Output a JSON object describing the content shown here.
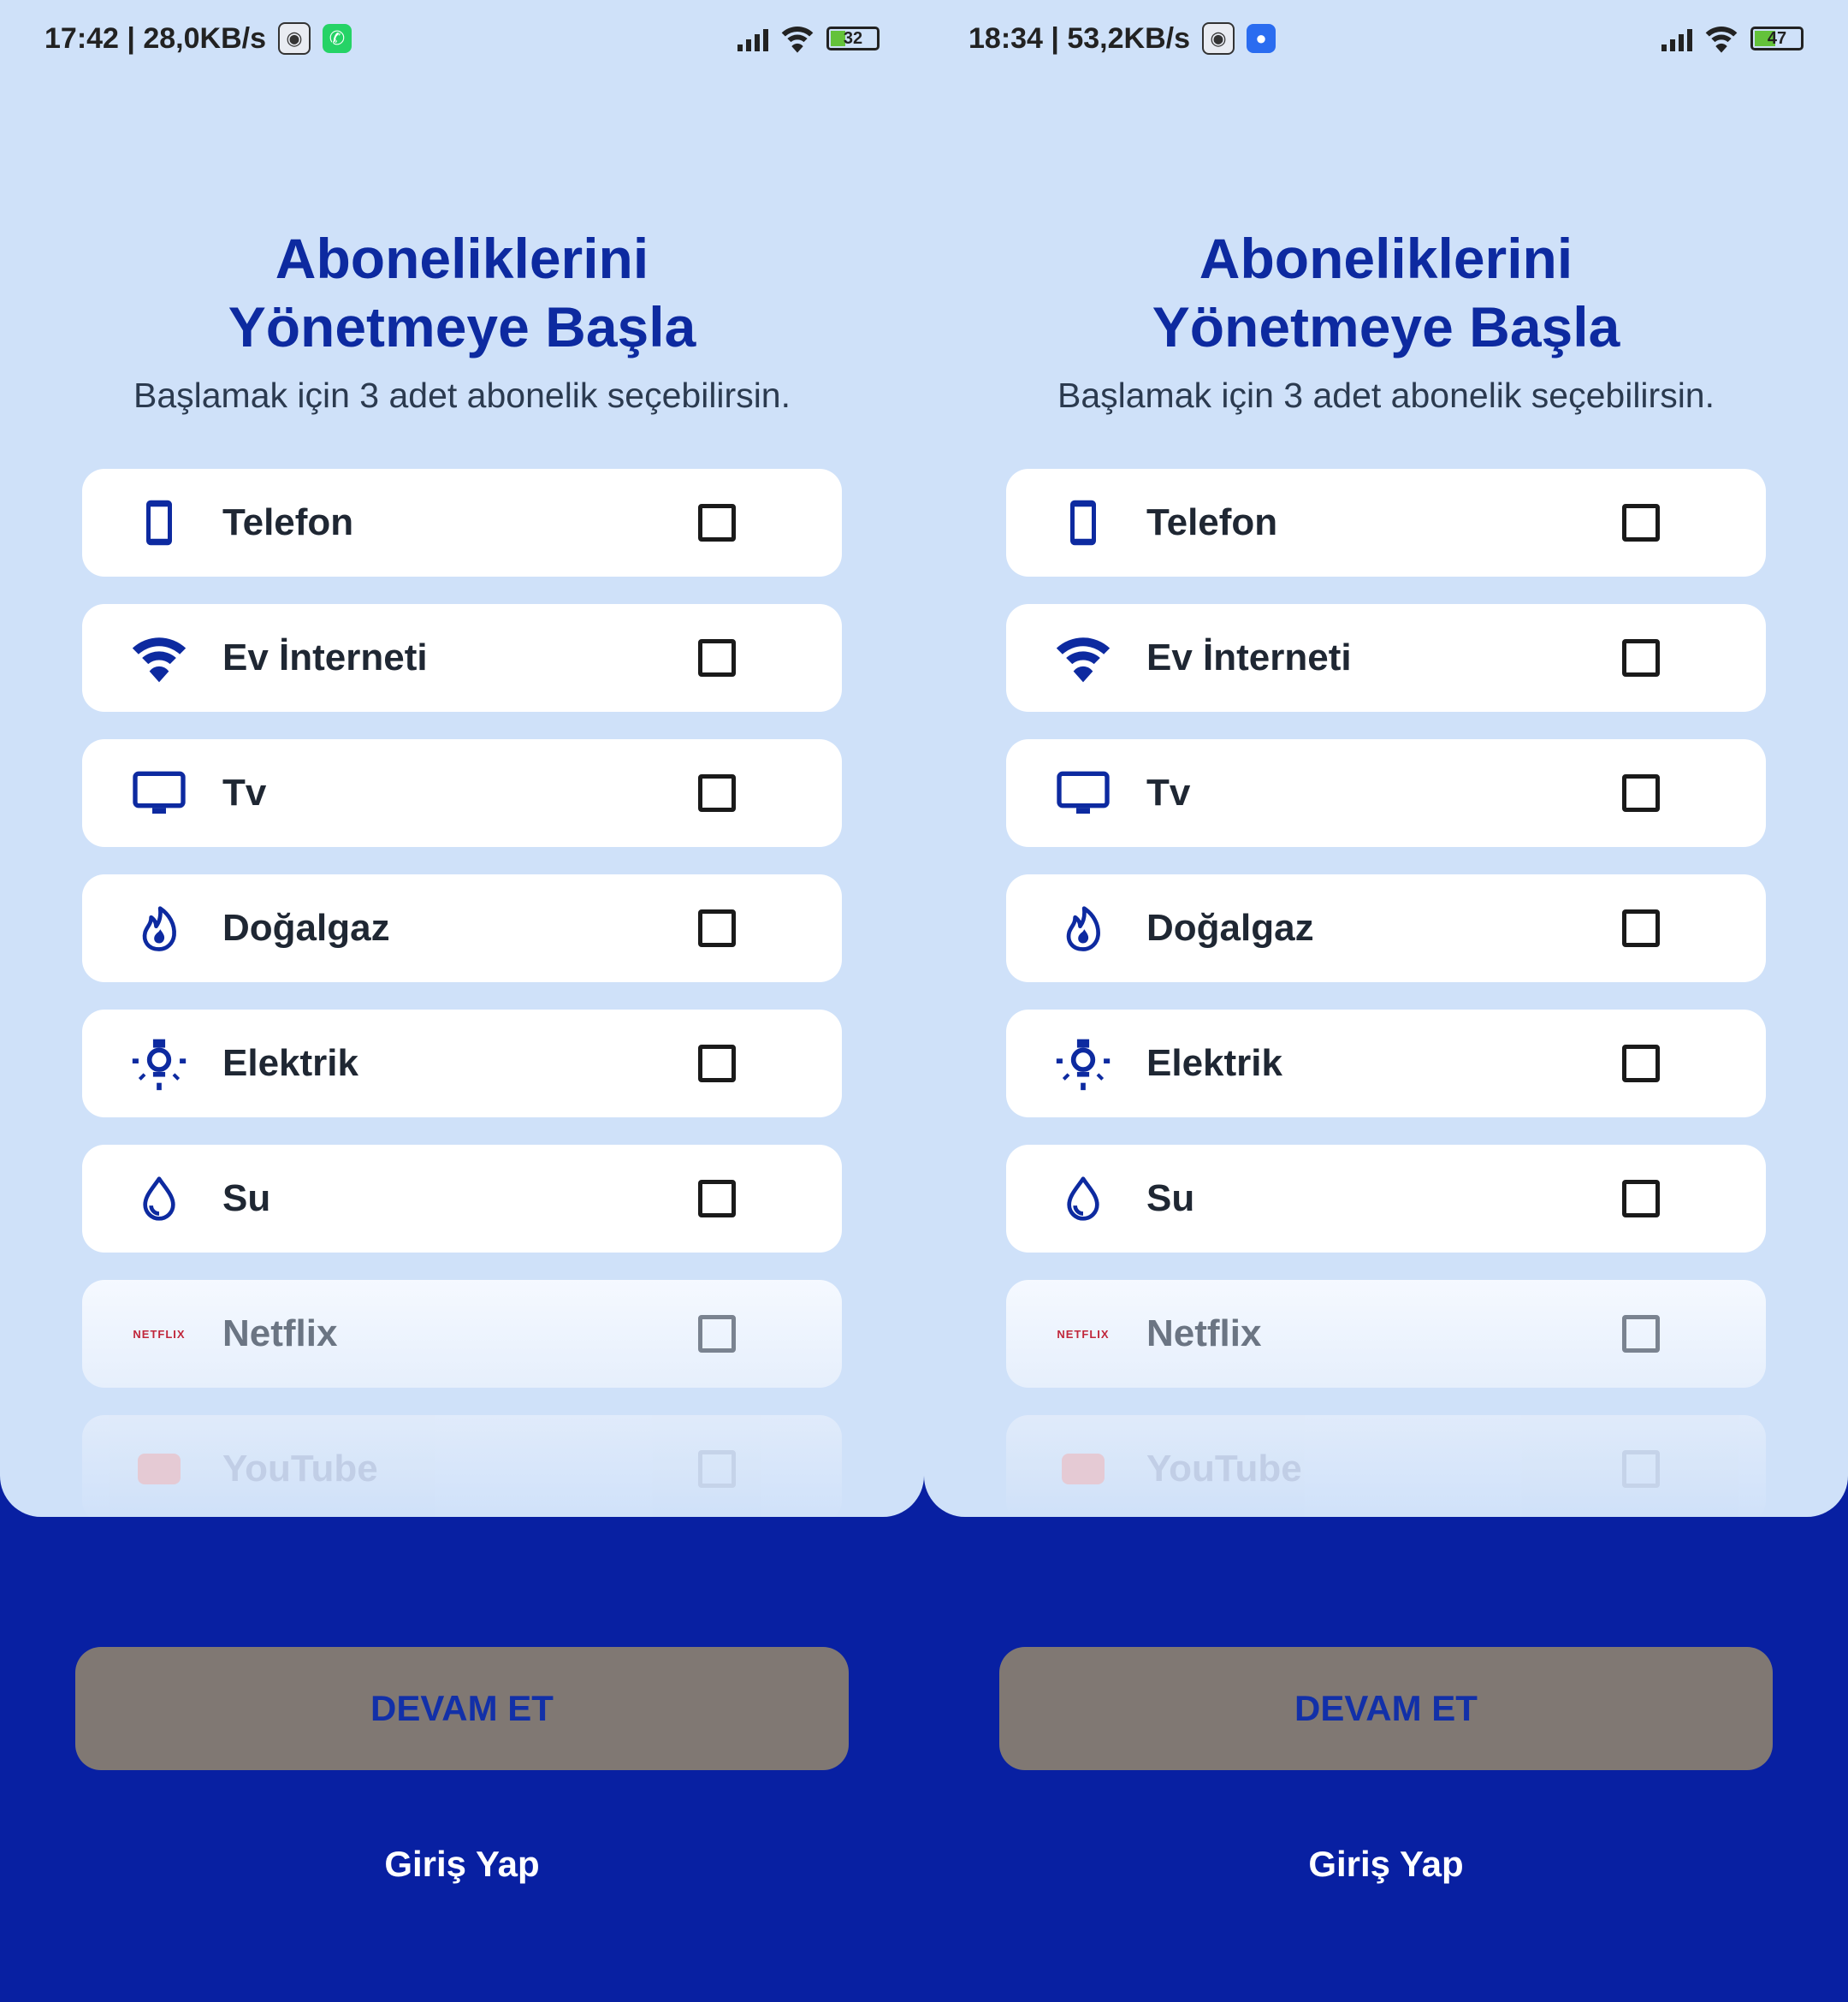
{
  "colors": {
    "accent": "#0d2aa0",
    "background_dark": "#0820a2",
    "panel": "#cfe1f9",
    "button": "#807873"
  },
  "screens": [
    {
      "status": {
        "time": "17:42 | 28,0KB/s",
        "battery": "32",
        "battery_fill": 0.32,
        "app_icon": "whatsapp-icon"
      },
      "title_line1": "Aboneliklerini",
      "title_line2": "Yönetmeye Başla",
      "subtitle": "Başlamak için 3 adet abonelik seçebilirsin.",
      "items": [
        {
          "label": "Telefon",
          "icon": "phone-icon"
        },
        {
          "label": "Ev İnterneti",
          "icon": "wifi-icon"
        },
        {
          "label": "Tv",
          "icon": "tv-icon"
        },
        {
          "label": "Doğalgaz",
          "icon": "flame-icon"
        },
        {
          "label": "Elektrik",
          "icon": "bulb-icon"
        },
        {
          "label": "Su",
          "icon": "water-drop-icon"
        },
        {
          "label": "Netflix",
          "icon": "netflix-logo",
          "logo_text": "NETFLIX"
        },
        {
          "label": "YouTube",
          "icon": "youtube-logo"
        }
      ],
      "continue_label": "DEVAM ET",
      "login_label": "Giriş Yap"
    },
    {
      "status": {
        "time": "18:34 | 53,2KB/s",
        "battery": "47",
        "battery_fill": 0.47,
        "app_icon": "messages-icon"
      },
      "title_line1": "Aboneliklerini",
      "title_line2": "Yönetmeye Başla",
      "subtitle": "Başlamak için 3 adet abonelik seçebilirsin.",
      "items": [
        {
          "label": "Telefon",
          "icon": "phone-icon"
        },
        {
          "label": "Ev İnterneti",
          "icon": "wifi-icon"
        },
        {
          "label": "Tv",
          "icon": "tv-icon"
        },
        {
          "label": "Doğalgaz",
          "icon": "flame-icon"
        },
        {
          "label": "Elektrik",
          "icon": "bulb-icon"
        },
        {
          "label": "Su",
          "icon": "water-drop-icon"
        },
        {
          "label": "Netflix",
          "icon": "netflix-logo",
          "logo_text": "NETFLIX"
        },
        {
          "label": "YouTube",
          "icon": "youtube-logo"
        }
      ],
      "continue_label": "DEVAM ET",
      "login_label": "Giriş Yap"
    }
  ]
}
